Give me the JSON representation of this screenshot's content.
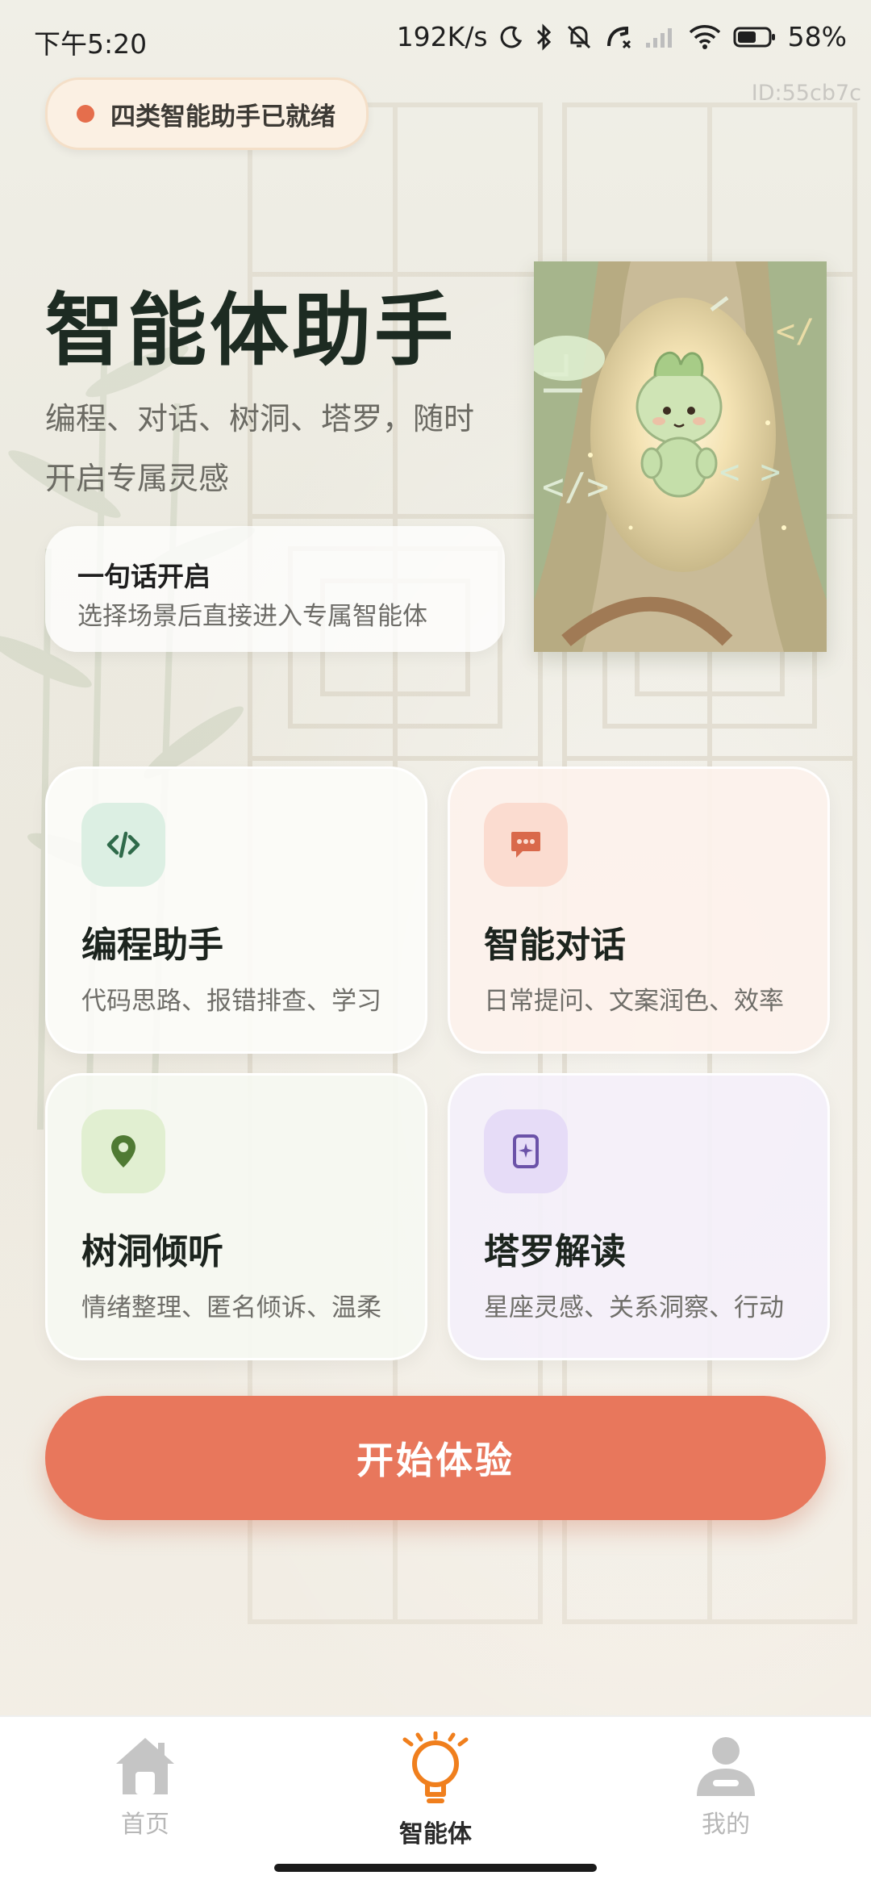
{
  "status_bar": {
    "time": "下午5:20",
    "network_speed": "192K/s",
    "battery": "58%",
    "icons": [
      "moon-icon",
      "bluetooth-icon",
      "mute-bell-icon",
      "call-off-icon",
      "signal-icon",
      "wifi-icon",
      "battery-icon"
    ]
  },
  "device_id": "ID:55cb7c",
  "ready_badge": {
    "text": "四类智能助手已就绪",
    "dot_color": "#e56e4c"
  },
  "hero": {
    "title": "智能体助手",
    "subtitle": "编程、对话、树洞、塔罗，随时开启专属灵感",
    "quick_card": {
      "title": "一句话开启",
      "desc": "选择场景后直接进入专属智能体"
    }
  },
  "agents": [
    {
      "title": "编程助手",
      "desc": "代码思路、报错排查、学习",
      "icon": "code-icon",
      "accent": "#2f6a4a"
    },
    {
      "title": "智能对话",
      "desc": "日常提问、文案润色、效率",
      "icon": "chat-bubble-icon",
      "accent": "#d9694b"
    },
    {
      "title": "树洞倾听",
      "desc": "情绪整理、匿名倾诉、温柔",
      "icon": "location-pin-icon",
      "accent": "#4f7a33"
    },
    {
      "title": "塔罗解读",
      "desc": "星座灵感、关系洞察、行动",
      "icon": "tarot-card-icon",
      "accent": "#6b52a8"
    }
  ],
  "cta": {
    "label": "开始体验",
    "color": "#e8775c"
  },
  "bottom_nav": {
    "items": [
      {
        "label": "首页",
        "icon": "home-icon",
        "active": false
      },
      {
        "label": "智能体",
        "icon": "lightbulb-icon",
        "active": true
      },
      {
        "label": "我的",
        "icon": "user-icon",
        "active": false
      }
    ],
    "active_color": "#f07f1d"
  }
}
